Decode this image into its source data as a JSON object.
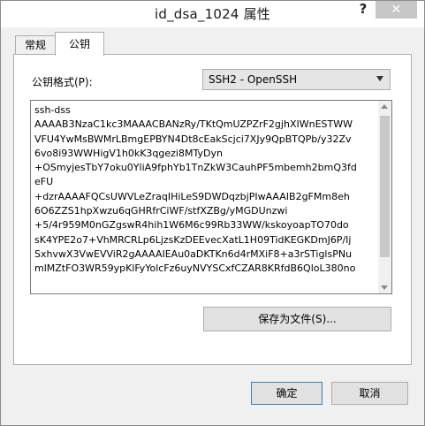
{
  "window": {
    "title": "id_dsa_1024 属性",
    "help_label": "?",
    "close_label": "✕"
  },
  "tabs": [
    {
      "label": "常规",
      "active": false
    },
    {
      "label": "公钥",
      "active": true
    }
  ],
  "format": {
    "label": "公钥格式(P):",
    "selected": "SSH2 - OpenSSH"
  },
  "key_lines": [
    "ssh-dss",
    "AAAAB3NzaC1kc3MAAACBANzRy/TKtQmUZPZrF2gjhXIWnESTWW",
    "VFU4YwMsBWMrLBmgEPBYN4Dt8cEakScjci7XJy9QpBTQPb/y32Zv",
    "6vo8i93WWHigV1h0kK3qgezi8MTyDyn",
    "+OSmyjesTbY7oku0YliA9fphYb1TnZkW3CauhPF5mbemh2bmQ3fd",
    "eFU",
    "+dzrAAAAFQCsUWVLeZraqIHiLeS9DWDqzbjPIwAAAIB2gFMm8eh",
    "6O6ZZS1hpXwzu6qGHRfrCiWF/stfXZBg/yMGDUnzwi",
    "+5/4r959M0nGZgswR4hih1W6M6c99Rb33WW/kskoyoapTO70do",
    "sK4YPE2o7+VhMRCRLp6LjzsKzDEEvecXatL1H09TidKEGKDmJ6P/Ij",
    "SxhvwX3VwEVViR2gAAAAIEAu0aDKTKn6d4rMXiF8+a3rSTiglsPNu",
    "mlMZtFO3WR59ypKlFyYolcFz6uyNVYSCxfCZAR8KRfdB6QloL380no"
  ],
  "buttons": {
    "save": "保存为文件(S)...",
    "ok": "确定",
    "cancel": "取消"
  }
}
